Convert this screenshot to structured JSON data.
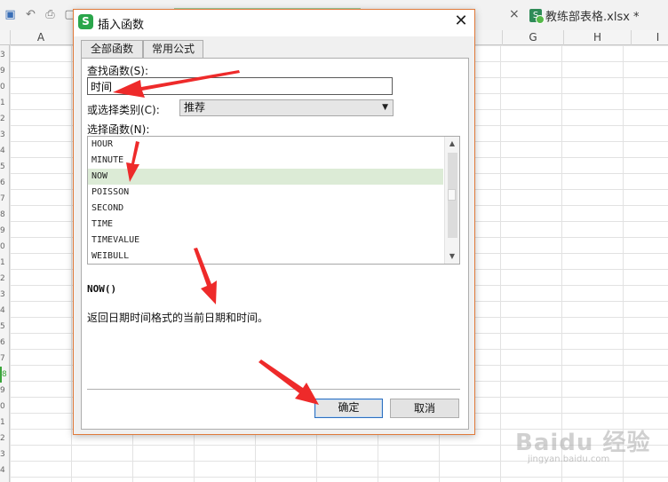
{
  "spreadsheet": {
    "doc_tab_title": "教练部表格.xlsx *",
    "doc_tab_close": "×",
    "columns": [
      "A",
      "G",
      "H",
      "I"
    ],
    "row_numbers": [
      "3",
      "9",
      "0",
      "1",
      "2",
      "3",
      "4",
      "5",
      "6",
      "7",
      "8",
      "9",
      "0",
      "1",
      "2",
      "3",
      "4",
      "5",
      "6",
      "7",
      "8",
      "9",
      "0",
      "1",
      "2",
      "3",
      "4"
    ]
  },
  "dialog": {
    "title": "插入函数",
    "close": "✕",
    "logo": "S",
    "tabs": [
      "全部函数",
      "常用公式"
    ],
    "search_label": "查找函数(S):",
    "search_value": "时间",
    "category_label": "或选择类别(C):",
    "category_value": "推荐",
    "function_label": "选择函数(N):",
    "functions": [
      "HOUR",
      "MINUTE",
      "NOW",
      "POISSON",
      "SECOND",
      "TIME",
      "TIMEVALUE",
      "WEIBULL"
    ],
    "selected_function": "NOW",
    "signature": "NOW()",
    "description": "返回日期时间格式的当前日期和时间。",
    "ok_label": "确定",
    "cancel_label": "取消"
  },
  "watermark": {
    "main": "Baidu 经验",
    "sub": "jingyan.baidu.com"
  },
  "colors": {
    "dialog_border": "#e07a3a",
    "selected_row": "#dcebd6",
    "arrow_red": "#ee2a2a",
    "ok_border": "#2d6fbf"
  }
}
